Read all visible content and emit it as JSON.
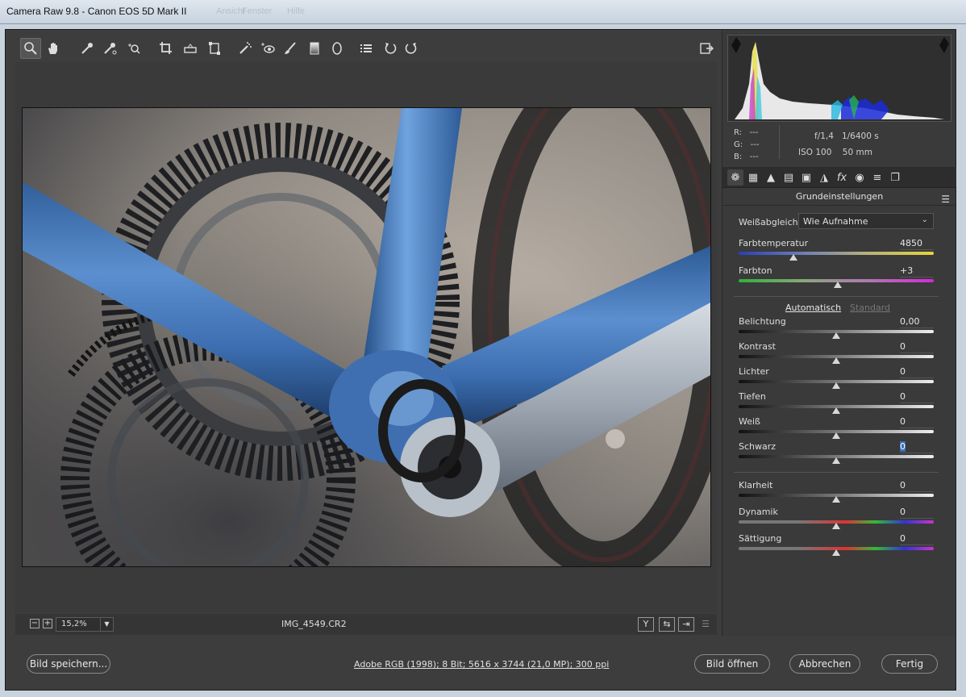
{
  "window": {
    "title": "Camera Raw 9.8 - Canon EOS 5D Mark II",
    "background_menu": [
      "Ansicht",
      "Fenster",
      "Hilfe"
    ]
  },
  "toolbar": {
    "tools": [
      "zoom-icon",
      "hand-icon",
      "white-balance-icon",
      "color-sampler-icon",
      "targeted-adjustment-icon",
      "crop-icon",
      "straighten-icon",
      "transform-icon",
      "spot-removal-icon",
      "red-eye-icon",
      "adjustment-brush-icon",
      "graduated-filter-icon",
      "radial-filter-icon",
      "preferences-icon",
      "rotate-left-icon",
      "rotate-right-icon"
    ],
    "fullscreen_icon": "fullscreen-icon"
  },
  "status": {
    "zoom_out": "−",
    "zoom_in": "+",
    "zoom_value": "15,2%",
    "filename": "IMG_4549.CR2",
    "compare_icons": [
      "Y",
      "⇆",
      "⇥",
      "☰"
    ]
  },
  "readout": {
    "r_label": "R:",
    "r_value": "---",
    "g_label": "G:",
    "g_value": "---",
    "b_label": "B:",
    "b_value": "---",
    "aperture": "f/1,4",
    "shutter": "1/6400 s",
    "iso": "ISO 100",
    "focal": "50 mm"
  },
  "panel": {
    "title": "Grundeinstellungen",
    "wb_label": "Weißabgleich:",
    "wb_value": "Wie Aufnahme",
    "auto_label": "Automatisch",
    "default_label": "Standard",
    "sliders": [
      {
        "label": "Farbtemperatur",
        "value": "4850",
        "position": 0.28,
        "track": "temp"
      },
      {
        "label": "Farbton",
        "value": "+3",
        "position": 0.51,
        "track": "tint"
      },
      {
        "label": "Belichtung",
        "value": "0,00",
        "position": 0.5,
        "track": "gray"
      },
      {
        "label": "Kontrast",
        "value": "0",
        "position": 0.5,
        "track": "gray"
      },
      {
        "label": "Lichter",
        "value": "0",
        "position": 0.5,
        "track": "gray"
      },
      {
        "label": "Tiefen",
        "value": "0",
        "position": 0.5,
        "track": "gray"
      },
      {
        "label": "Weiß",
        "value": "0",
        "position": 0.5,
        "track": "gray"
      },
      {
        "label": "Schwarz",
        "value": "0",
        "position": 0.5,
        "track": "gray"
      },
      {
        "label": "Klarheit",
        "value": "0",
        "position": 0.5,
        "track": "gray"
      },
      {
        "label": "Dynamik",
        "value": "0",
        "position": 0.5,
        "track": "spectrum"
      },
      {
        "label": "Sättigung",
        "value": "0",
        "position": 0.5,
        "track": "spectrum"
      }
    ]
  },
  "footer": {
    "save_label": "Bild speichern...",
    "workflow_label": "Adobe RGB (1998); 8 Bit; 5616 x 3744 (21,0 MP); 300 ppi",
    "open_label": "Bild öffnen",
    "cancel_label": "Abbrechen",
    "done_label": "Fertig"
  }
}
